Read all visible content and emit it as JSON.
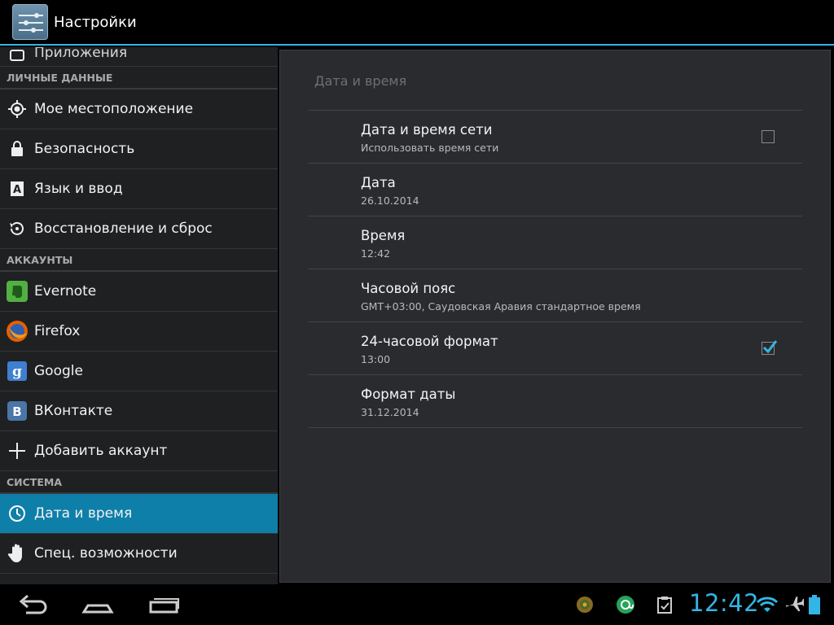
{
  "actionbar": {
    "title": "Настройки",
    "icon": "settings-sliders-icon"
  },
  "sidebar": {
    "partial_item": {
      "label": "Приложения",
      "icon": "apps-icon"
    },
    "sections": [
      {
        "header": "ЛИЧНЫЕ ДАННЫЕ",
        "items": [
          {
            "label": "Мое местоположение",
            "icon": "location-icon"
          },
          {
            "label": "Безопасность",
            "icon": "lock-icon"
          },
          {
            "label": "Язык и ввод",
            "icon": "keyboard-language-icon"
          },
          {
            "label": "Восстановление и сброс",
            "icon": "restore-icon"
          }
        ]
      },
      {
        "header": "АККАУНТЫ",
        "items": [
          {
            "label": "Evernote",
            "icon": "evernote-icon"
          },
          {
            "label": "Firefox",
            "icon": "firefox-icon"
          },
          {
            "label": "Google",
            "icon": "google-icon"
          },
          {
            "label": "ВКонтакте",
            "icon": "vk-icon"
          },
          {
            "label": "Добавить аккаунт",
            "icon": "plus-icon"
          }
        ]
      },
      {
        "header": "СИСТЕМА",
        "items": [
          {
            "label": "Дата и время",
            "icon": "clock-icon",
            "selected": true
          },
          {
            "label": "Спец. возможности",
            "icon": "hand-icon"
          }
        ]
      }
    ]
  },
  "detail": {
    "title": "Дата и время",
    "rows": [
      {
        "title": "Дата и время сети",
        "subtitle": "Использовать время сети",
        "checkbox": "unchecked"
      },
      {
        "title": "Дата",
        "subtitle": "26.10.2014"
      },
      {
        "title": "Время",
        "subtitle": "12:42"
      },
      {
        "title": "Часовой пояс",
        "subtitle": "GMT+03:00, Саудовская Аравия стандартное время"
      },
      {
        "title": "24-часовой формат",
        "subtitle": "13:00",
        "checkbox": "checked"
      },
      {
        "title": "Формат даты",
        "subtitle": "31.12.2014"
      }
    ]
  },
  "navbar": {
    "buttons": [
      "back-icon",
      "home-icon",
      "recent-apps-icon"
    ],
    "notifications": [
      "gear-flower-icon",
      "at-sign-icon",
      "clipboard-check-icon"
    ],
    "clock": "12:42",
    "status_icons": [
      "wifi-icon",
      "airplane-icon",
      "battery-icon"
    ]
  },
  "colors": {
    "accent": "#33b5e5",
    "selected_bg": "#0e7fa9"
  }
}
